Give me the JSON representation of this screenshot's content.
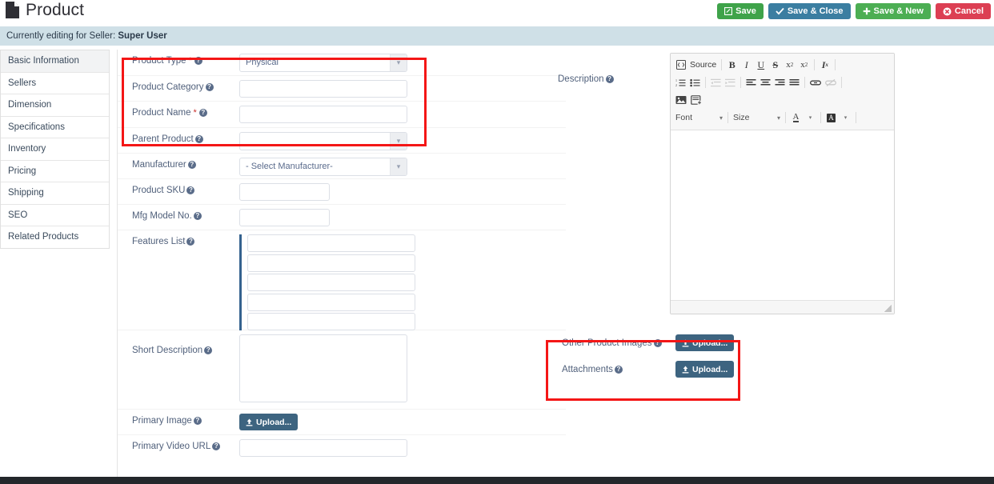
{
  "header": {
    "title": "Product",
    "icon": "document-icon",
    "actions": [
      {
        "label": "Save",
        "icon": "edit-square-icon",
        "color": "#3fa34a",
        "name": "save-button"
      },
      {
        "label": "Save & Close",
        "icon": "check-icon",
        "color": "#3b7ea1",
        "name": "save-and-close-button"
      },
      {
        "label": "Save & New",
        "icon": "plus-icon",
        "color": "#4cae53",
        "name": "save-and-new-button"
      },
      {
        "label": "Cancel",
        "icon": "close-circle-icon",
        "color": "#dc3f53",
        "name": "cancel-button"
      }
    ]
  },
  "notice": {
    "prefix": "Currently editing for Seller:",
    "seller": "Super User",
    "background": "#cfe0e7"
  },
  "sidebar": {
    "items": [
      {
        "label": "Basic Information",
        "active": true
      },
      {
        "label": "Sellers",
        "active": false
      },
      {
        "label": "Dimension",
        "active": false
      },
      {
        "label": "Specifications",
        "active": false
      },
      {
        "label": "Inventory",
        "active": false
      },
      {
        "label": "Pricing",
        "active": false
      },
      {
        "label": "Shipping",
        "active": false
      },
      {
        "label": "SEO",
        "active": false
      },
      {
        "label": "Related Products",
        "active": false
      }
    ]
  },
  "form": {
    "product_type": {
      "label": "Product Type",
      "required": true,
      "value": "Physical",
      "control": "select"
    },
    "product_category": {
      "label": "Product Category",
      "required": false,
      "value": "",
      "control": "text"
    },
    "product_name": {
      "label": "Product Name",
      "required": true,
      "value": "",
      "control": "text"
    },
    "parent_product": {
      "label": "Parent Product",
      "required": false,
      "value": "",
      "control": "select"
    },
    "manufacturer": {
      "label": "Manufacturer",
      "required": false,
      "value": "- Select Manufacturer-",
      "control": "select"
    },
    "product_sku": {
      "label": "Product SKU",
      "required": false,
      "value": "",
      "control": "text"
    },
    "mfg_model_no": {
      "label": "Mfg Model No.",
      "required": false,
      "value": "",
      "control": "text"
    },
    "features_list": {
      "label": "Features List",
      "required": false,
      "values": [
        "",
        "",
        "",
        "",
        ""
      ],
      "accent": "#35628f"
    },
    "short_description": {
      "label": "Short Description",
      "required": false,
      "value": ""
    },
    "primary_image": {
      "label": "Primary Image",
      "required": false,
      "upload_label": "Upload..."
    },
    "primary_video_url": {
      "label": "Primary Video URL",
      "required": false,
      "value": ""
    }
  },
  "description": {
    "label": "Description",
    "editor": {
      "source_label": "Source",
      "font_label": "Font",
      "size_label": "Size",
      "content": "",
      "toolbar_row1": [
        {
          "name": "source-icon",
          "glyph": "▤",
          "dim": false
        },
        {
          "name": "bold-icon",
          "glyph": "B",
          "dim": false
        },
        {
          "name": "italic-icon",
          "glyph": "I",
          "dim": false
        },
        {
          "name": "underline-icon",
          "glyph": "U",
          "dim": false
        },
        {
          "name": "strikethrough-icon",
          "glyph": "S",
          "dim": false
        },
        {
          "name": "subscript-icon",
          "glyph": "x₂",
          "dim": false
        },
        {
          "name": "superscript-icon",
          "glyph": "x²",
          "dim": false
        },
        {
          "name": "remove-format-icon",
          "glyph": "ᵛₓ",
          "dim": false
        }
      ],
      "toolbar_row2": [
        {
          "name": "numbered-list-icon",
          "glyph": "≡",
          "dim": false
        },
        {
          "name": "bulleted-list-icon",
          "glyph": "☰",
          "dim": false
        },
        {
          "name": "outdent-icon",
          "glyph": "≡",
          "dim": true
        },
        {
          "name": "indent-icon",
          "glyph": "≡",
          "dim": true
        },
        {
          "name": "align-left-icon",
          "glyph": "≡",
          "dim": false
        },
        {
          "name": "align-center-icon",
          "glyph": "≡",
          "dim": false
        },
        {
          "name": "align-right-icon",
          "glyph": "≡",
          "dim": false
        },
        {
          "name": "justify-icon",
          "glyph": "≡",
          "dim": false
        },
        {
          "name": "link-icon",
          "glyph": "⚭",
          "dim": false
        },
        {
          "name": "unlink-icon",
          "glyph": "⚭",
          "dim": true
        }
      ],
      "toolbar_row3": [
        {
          "name": "image-icon",
          "glyph": "⛰",
          "dim": false
        },
        {
          "name": "page-break-icon",
          "glyph": "▦",
          "dim": false
        }
      ],
      "text_color_label": "A",
      "bg_color_label": "A"
    }
  },
  "uploads": {
    "other_product_images": {
      "label": "Other Product Images",
      "button": "Upload..."
    },
    "attachments": {
      "label": "Attachments",
      "button": "Upload..."
    }
  },
  "annotations": {
    "box1_name": "highlight-box-product-identity",
    "box2_name": "highlight-box-uploads",
    "color": "#f41616"
  }
}
